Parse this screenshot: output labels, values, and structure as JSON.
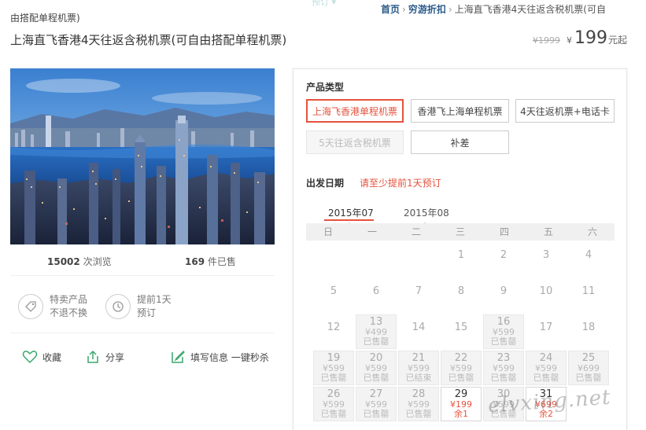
{
  "breadcrumb": {
    "home": "首页",
    "category": "穷游折扣",
    "current": "上海直飞香港4天往返含税机票(可自"
  },
  "ghost_text": "预订 ▾",
  "product": {
    "title_prefix": "由搭配单程机票)",
    "title": "上海直飞香港4天往返含税机票(可自由搭配单程机票)"
  },
  "price": {
    "original": "¥1999",
    "currency": "¥",
    "current": "199",
    "suffix": "元起"
  },
  "stats": {
    "views_count": "15002",
    "views_label": " 次浏览",
    "sold_count": "169",
    "sold_label": " 件已售"
  },
  "features": [
    {
      "icon": "tag-icon",
      "line1": "特卖产品",
      "line2": "不退不换"
    },
    {
      "icon": "clock-icon",
      "line1": "提前1天",
      "line2": "预订"
    }
  ],
  "actions": {
    "favorite": "收藏",
    "share": "分享",
    "fill_info": "填写信息 一键秒杀"
  },
  "product_type": {
    "label": "产品类型",
    "options": [
      {
        "label": "上海飞香港单程机票",
        "state": "selected"
      },
      {
        "label": "香港飞上海单程机票",
        "state": "normal"
      },
      {
        "label": "4天往返机票+电话卡",
        "state": "normal"
      },
      {
        "label": "5天往返含税机票",
        "state": "disabled"
      },
      {
        "label": "补差",
        "state": "normal"
      }
    ]
  },
  "departure": {
    "label": "出发日期",
    "hint": "请至少提前1天预订",
    "months": [
      "2015年07",
      "2015年08"
    ],
    "weekdays": [
      "日",
      "一",
      "二",
      "三",
      "四",
      "五",
      "六"
    ],
    "rows": [
      [
        {
          "d": ""
        },
        {
          "d": ""
        },
        {
          "d": ""
        },
        {
          "d": "1"
        },
        {
          "d": "2"
        },
        {
          "d": "3"
        },
        {
          "d": "4"
        }
      ],
      [
        {
          "d": "5"
        },
        {
          "d": "6"
        },
        {
          "d": "7"
        },
        {
          "d": "8"
        },
        {
          "d": "9"
        },
        {
          "d": "10"
        },
        {
          "d": "11"
        }
      ],
      [
        {
          "d": "12"
        },
        {
          "d": "13",
          "p": "¥499",
          "s": "已售罄"
        },
        {
          "d": "14"
        },
        {
          "d": "15"
        },
        {
          "d": "16",
          "p": "¥599",
          "s": "已售罄"
        },
        {
          "d": "17"
        },
        {
          "d": "18"
        }
      ],
      [
        {
          "d": "19",
          "p": "¥599",
          "s": "已售罄"
        },
        {
          "d": "20",
          "p": "¥599",
          "s": "已售罄"
        },
        {
          "d": "21",
          "p": "¥599",
          "s": "已结束"
        },
        {
          "d": "22",
          "p": "¥599",
          "s": "已售罄"
        },
        {
          "d": "23",
          "p": "¥599",
          "s": "已售罄"
        },
        {
          "d": "24",
          "p": "¥599",
          "s": "已售罄"
        },
        {
          "d": "25",
          "p": "¥699",
          "s": "已售罄"
        }
      ],
      [
        {
          "d": "26",
          "p": "¥599",
          "s": "已售罄"
        },
        {
          "d": "27",
          "p": "¥599",
          "s": "已售罄"
        },
        {
          "d": "28",
          "p": "¥599",
          "s": "已售罄"
        },
        {
          "d": "29",
          "p": "¥199",
          "s": "余1",
          "avail": true
        },
        {
          "d": "30",
          "p": "¥599",
          "s": "已售罄"
        },
        {
          "d": "31",
          "p": "¥699",
          "s": "余2",
          "avail": true
        },
        {
          "d": ""
        }
      ]
    ]
  },
  "watermark": "elvxing.net",
  "colors": {
    "accent": "#e5533d",
    "link": "#2a5a8a"
  }
}
